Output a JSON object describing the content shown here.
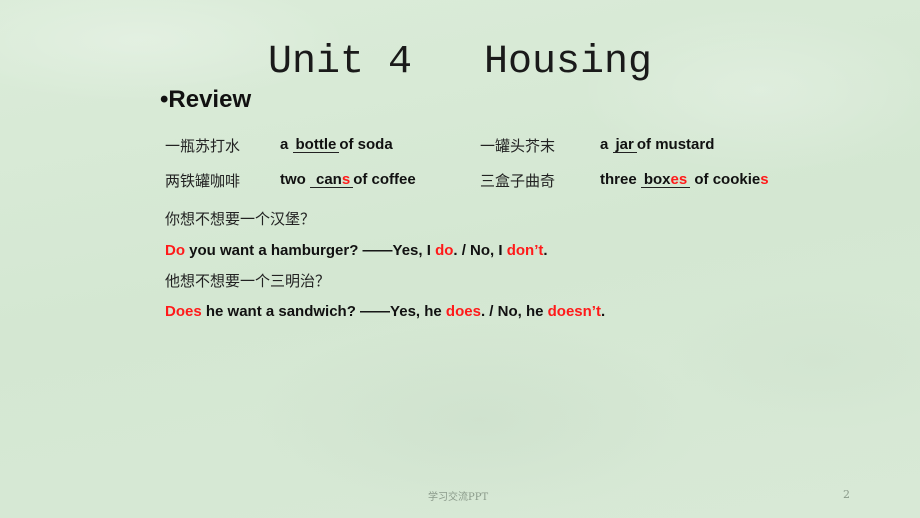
{
  "slide": {
    "title": "Unit 4   Housing",
    "section_heading": "•Review",
    "phrases": [
      {
        "cn": "一瓶苏打水",
        "pre": "a",
        "blank_black": "bottle",
        "blank_red": "",
        "post": "of soda",
        "post_red": ""
      },
      {
        "cn": "一罐头芥末",
        "pre": "a",
        "blank_black": "jar",
        "blank_red": "",
        "post": "of mustard",
        "post_red": ""
      },
      {
        "cn": "两铁罐咖啡",
        "pre": "two",
        "blank_black": "can",
        "blank_red": "s",
        "post": "of coffee",
        "post_red": ""
      },
      {
        "cn": "三盒子曲奇",
        "pre": "three",
        "blank_black": "box",
        "blank_red": "es",
        "post": "of cookie",
        "post_red": "s"
      }
    ],
    "questions": [
      {
        "cn": "你想不想要一个汉堡？",
        "parts": [
          {
            "text": "Do",
            "red": true
          },
          {
            "text": " you want a hamburger? ——Yes, I ",
            "red": false
          },
          {
            "text": "do",
            "red": true
          },
          {
            "text": ". / No, I ",
            "red": false
          },
          {
            "text": "don’t",
            "red": true
          },
          {
            "text": ".",
            "red": false
          }
        ]
      },
      {
        "cn": "他想不想要一个三明治？",
        "parts": [
          {
            "text": "Does",
            "red": true
          },
          {
            "text": " he want a sandwich? ——Yes, he ",
            "red": false
          },
          {
            "text": "does",
            "red": true
          },
          {
            "text": ". / No, he ",
            "red": false
          },
          {
            "text": "doesn’t",
            "red": true
          },
          {
            "text": ".",
            "red": false
          }
        ]
      }
    ],
    "footer": "学习交流PPT",
    "page_number": "2"
  },
  "colors": {
    "background": "#d7e9d5",
    "text": "#111111",
    "highlight": "#ff1a1a",
    "footer": "#8a9a8a"
  }
}
